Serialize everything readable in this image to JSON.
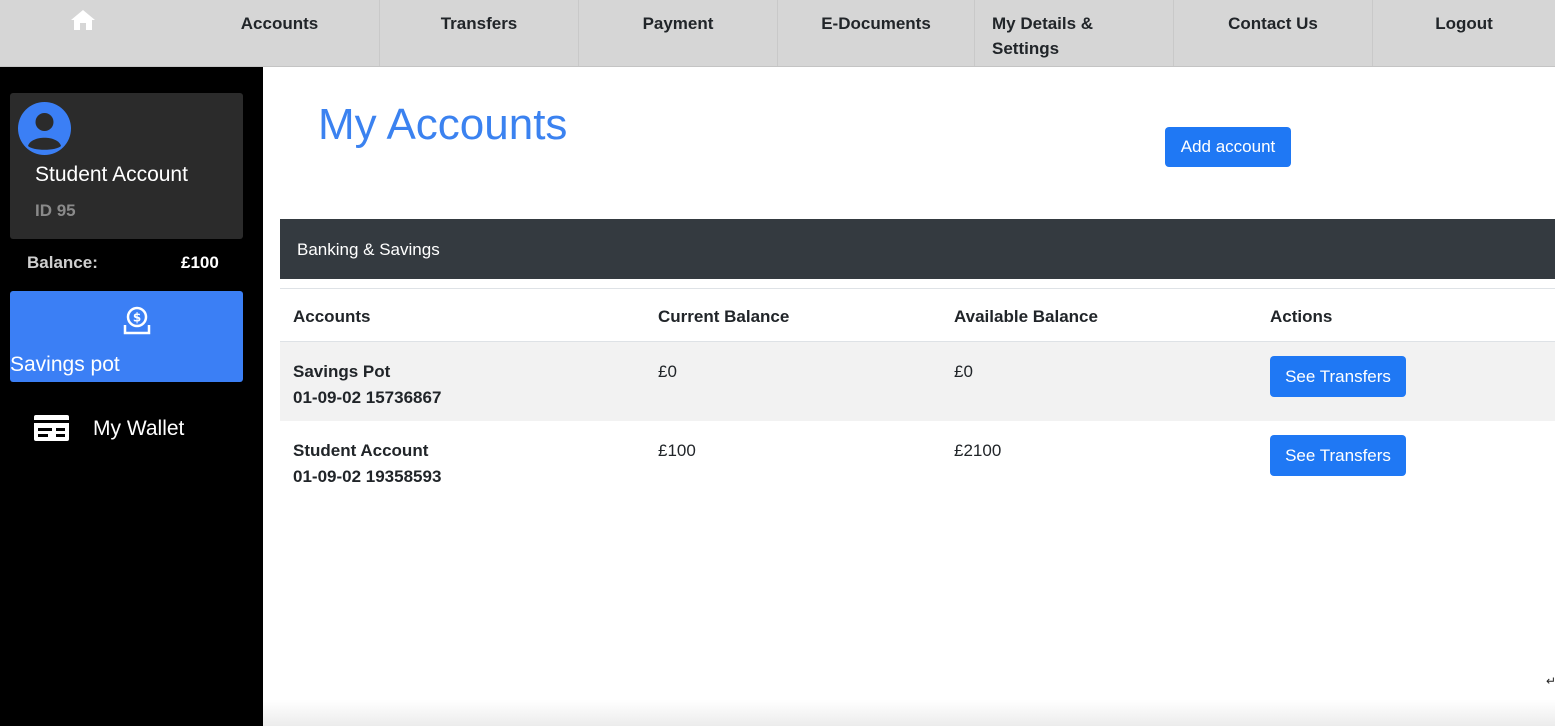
{
  "nav": {
    "home_icon": "home-icon",
    "items": [
      {
        "label": "Accounts"
      },
      {
        "label": "Transfers"
      },
      {
        "label": "Payment"
      },
      {
        "label": "E-Documents"
      },
      {
        "label_line1": "My Details &",
        "label_line2": "Settings"
      },
      {
        "label": "Contact Us"
      },
      {
        "label": "Logout"
      }
    ]
  },
  "sidebar": {
    "profile": {
      "avatar_icon": "user-avatar-icon",
      "name": "Student Account",
      "id": "ID 95"
    },
    "balance_label": "Balance:",
    "balance_value": "£100",
    "savings_pot": {
      "icon": "money-pot-icon",
      "label": "Savings pot"
    },
    "wallet": {
      "icon": "wallet-card-icon",
      "label": "My Wallet"
    }
  },
  "main": {
    "title": "My Accounts",
    "add_account_label": "Add account",
    "section_title": "Banking & Savings",
    "table": {
      "headers": [
        "Accounts",
        "Current Balance",
        "Available Balance",
        "Actions"
      ],
      "rows": [
        {
          "name": "Savings Pot",
          "number": "01-09-02 15736867",
          "current": "£0",
          "available": "£0",
          "action": "See Transfers"
        },
        {
          "name": "Student Account",
          "number": "01-09-02 19358593",
          "current": "£100",
          "available": "£2100",
          "action": "See Transfers"
        }
      ]
    }
  },
  "colors": {
    "accent": "#1f78f4",
    "title": "#3b82f0",
    "sidebar_bg": "#000000",
    "section_header_bg": "#343a40",
    "nav_bg": "#d6d6d6"
  }
}
